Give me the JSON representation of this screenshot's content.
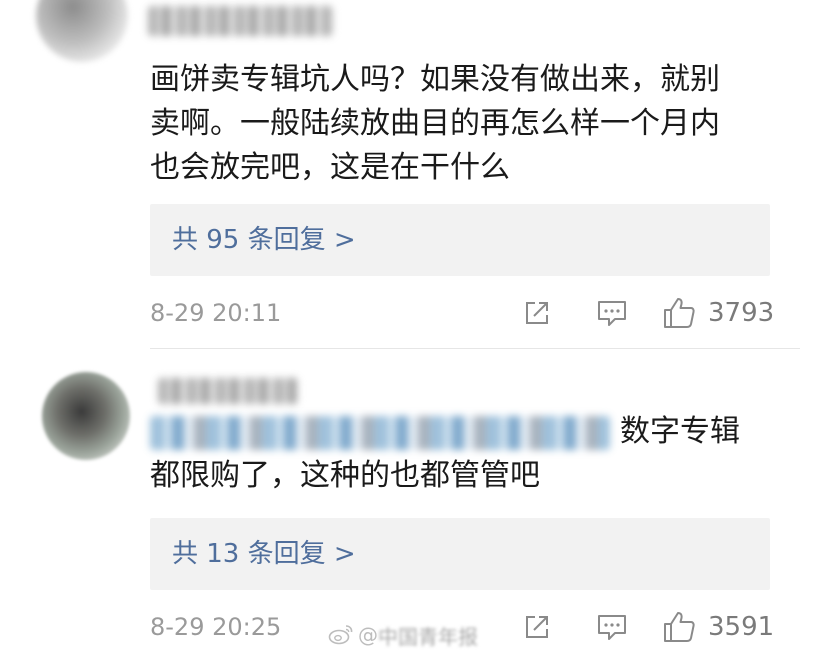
{
  "comments": [
    {
      "text_lines": [
        "画饼卖专辑坑人吗？如果没有做出来，就别",
        "卖啊。一般陆续放曲目的再怎么样一个月内",
        "也会放完吧，这是在干什么"
      ],
      "replies_label": "共 95 条回复 >",
      "timestamp": "8-29 20:11",
      "likes": "3793"
    },
    {
      "text_line1_tail": "数字专辑",
      "text_line2": "都限购了，这种的也都管管吧",
      "replies_label": "共 13 条回复 >",
      "timestamp": "8-29 20:25",
      "likes": "3591"
    }
  ],
  "icons": {
    "share": "share-icon",
    "comment": "comment-icon",
    "like": "thumbs-up-icon",
    "watermark": "weibo-icon"
  },
  "watermark": {
    "prefix": "@",
    "text": "中国青年报"
  },
  "colors": {
    "reply_link": "#4f6e9c",
    "reply_bg": "#f2f2f2",
    "meta_gray": "#9a9a9a"
  }
}
